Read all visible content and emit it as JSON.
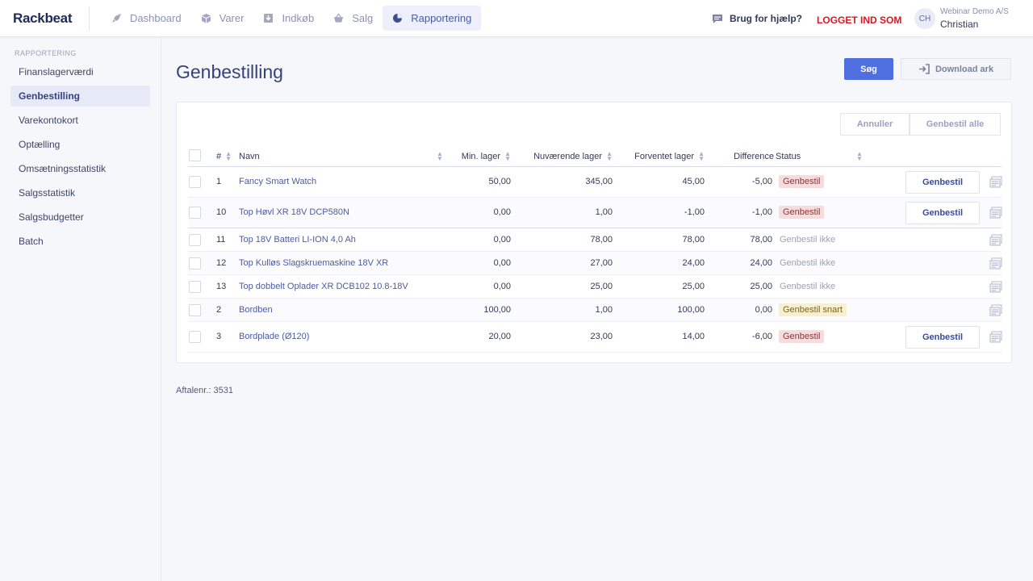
{
  "app": {
    "logo": "Rackbeat"
  },
  "nav": [
    {
      "label": "Dashboard",
      "icon": "rocket-icon"
    },
    {
      "label": "Varer",
      "icon": "cube-icon"
    },
    {
      "label": "Indkøb",
      "icon": "download-box-icon"
    },
    {
      "label": "Salg",
      "icon": "basket-icon"
    },
    {
      "label": "Rapportering",
      "icon": "pie-chart-icon",
      "active": true
    }
  ],
  "header": {
    "help": "Brug for hjælp?",
    "logged_in": "LOGGET IND SOM",
    "avatar_initials": "CH",
    "company": "Webinar Demo A/S",
    "user": "Christian"
  },
  "sidebar": {
    "heading": "RAPPORTERING",
    "items": [
      {
        "label": "Finanslagerværdi"
      },
      {
        "label": "Genbestilling",
        "active": true
      },
      {
        "label": "Varekontokort"
      },
      {
        "label": "Optælling"
      },
      {
        "label": "Omsætningsstatistik"
      },
      {
        "label": "Salgsstatistik"
      },
      {
        "label": "Salgsbudgetter"
      },
      {
        "label": "Batch"
      }
    ]
  },
  "main": {
    "title": "Genbestilling",
    "search_label": "Søg",
    "download_label": "Download ark",
    "cancel_label": "Annuller",
    "reorder_all_label": "Genbestil alle",
    "row_button_label": "Genbestil"
  },
  "table": {
    "columns": {
      "num": "#",
      "name": "Navn",
      "min": "Min. lager",
      "current": "Nuværende lager",
      "expected": "Forventet lager",
      "diff": "Difference",
      "status": "Status"
    },
    "rows": [
      {
        "num": "1",
        "name": "Fancy Smart Watch",
        "min": "50,00",
        "current": "345,00",
        "expected": "45,00",
        "diff": "-5,00",
        "status": "Genbestil",
        "status_type": "red",
        "has_button": true
      },
      {
        "num": "10",
        "name": "Top Høvl XR 18V DCP580N",
        "min": "0,00",
        "current": "1,00",
        "expected": "-1,00",
        "diff": "-1,00",
        "status": "Genbestil",
        "status_type": "red",
        "has_button": true
      },
      {
        "num": "11",
        "name": "Top 18V Batteri LI-ION 4,0 Ah",
        "min": "0,00",
        "current": "78,00",
        "expected": "78,00",
        "diff": "78,00",
        "status": "Genbestil ikke",
        "status_type": "gray",
        "has_button": false
      },
      {
        "num": "12",
        "name": "Top Kulløs Slagskruemaskine 18V XR",
        "min": "0,00",
        "current": "27,00",
        "expected": "24,00",
        "diff": "24,00",
        "status": "Genbestil ikke",
        "status_type": "gray",
        "has_button": false
      },
      {
        "num": "13",
        "name": "Top dobbelt Oplader XR DCB102 10.8-18V",
        "min": "0,00",
        "current": "25,00",
        "expected": "25,00",
        "diff": "25,00",
        "status": "Genbestil ikke",
        "status_type": "gray",
        "has_button": false
      },
      {
        "num": "2",
        "name": "Bordben",
        "min": "100,00",
        "current": "1,00",
        "expected": "100,00",
        "diff": "0,00",
        "status": "Genbestil snart",
        "status_type": "yellow",
        "has_button": false
      },
      {
        "num": "3",
        "name": "Bordplade (Ø120)",
        "min": "20,00",
        "current": "23,00",
        "expected": "14,00",
        "diff": "-6,00",
        "status": "Genbestil",
        "status_type": "red",
        "has_button": true
      }
    ]
  },
  "footer": {
    "agreement": "Aftalenr.: 3531"
  },
  "colors": {
    "accent": "#4f6fe0",
    "logged_in": "#e0141e",
    "status_red_bg": "#f6dcdc",
    "status_yellow_bg": "#f8efcf"
  }
}
